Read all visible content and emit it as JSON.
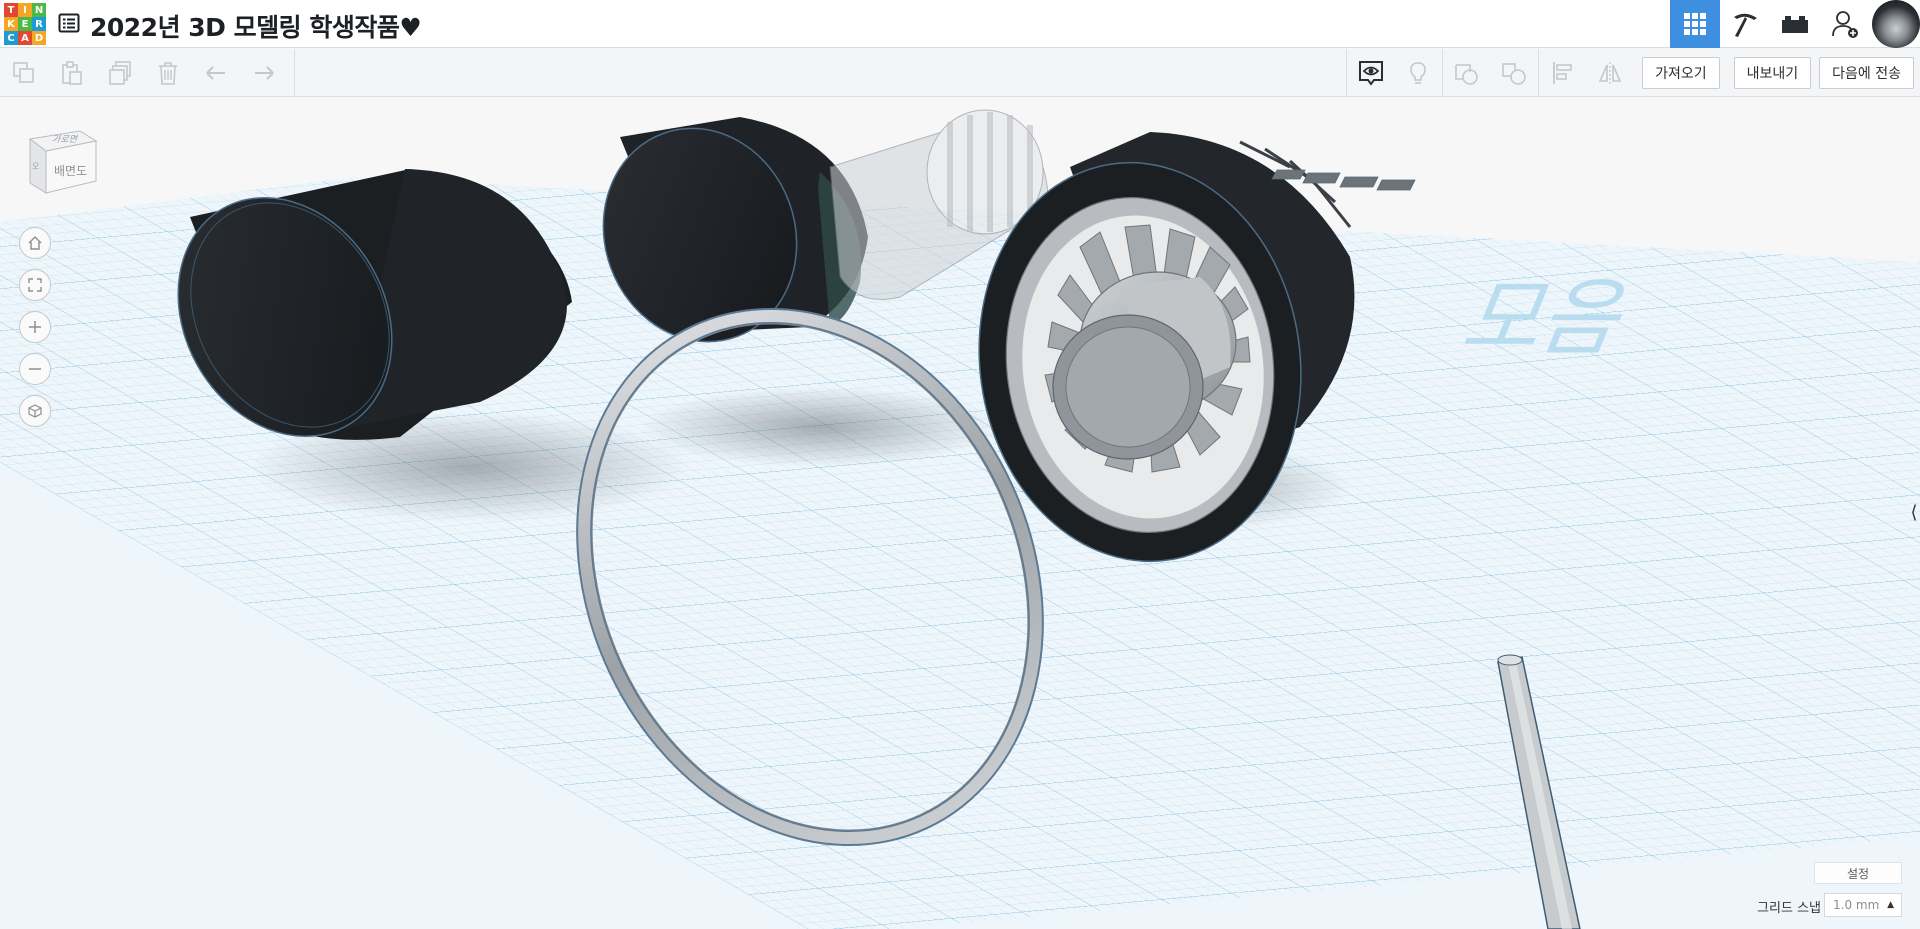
{
  "app": {
    "logo_letters": [
      "T",
      "I",
      "N",
      "K",
      "E",
      "R",
      "C",
      "A",
      "D"
    ],
    "logo_colors": [
      "#e2472f",
      "#f5a623",
      "#4cb848",
      "#f5a623",
      "#4cb848",
      "#1e9ad6",
      "#1e9ad6",
      "#e2472f",
      "#f5a623"
    ]
  },
  "document": {
    "title": "2022년 3D 모델링 학생작품♥"
  },
  "top_nav": {
    "items": [
      {
        "icon": "grid-view-icon",
        "active": true
      },
      {
        "icon": "pickaxe-icon",
        "active": false
      },
      {
        "icon": "bricks-icon",
        "active": false
      },
      {
        "icon": "add-user-icon",
        "active": false
      }
    ]
  },
  "toolbar": {
    "left_tools": [
      "copy-icon",
      "paste-icon",
      "duplicate-icon",
      "delete-icon",
      "undo-icon",
      "redo-icon"
    ],
    "right_tools": [
      "notes-eye-icon",
      "lightbulb-icon",
      "group-icon",
      "ungroup-icon",
      "align-icon",
      "mirror-icon"
    ],
    "import_label": "가져오기",
    "export_label": "내보내기",
    "send_label": "다음에 전송"
  },
  "viewcube": {
    "top_label": "가로면",
    "front_label": "배면도",
    "side_label": "오"
  },
  "nav_controls": [
    "home-view-icon",
    "fit-view-icon",
    "zoom-in-icon",
    "zoom-out-icon",
    "ortho-view-icon"
  ],
  "workplane": {
    "grid_color": "#6fb8dc",
    "text_mark": "모음"
  },
  "settings": {
    "settings_label": "설정",
    "grid_snap_label": "그리드 스냅",
    "grid_snap_value": "1.0 mm"
  },
  "colors": {
    "accent": "#3f8fe0",
    "dark_shape": "#1f2226",
    "gray_shape": "#a9aeb3"
  }
}
